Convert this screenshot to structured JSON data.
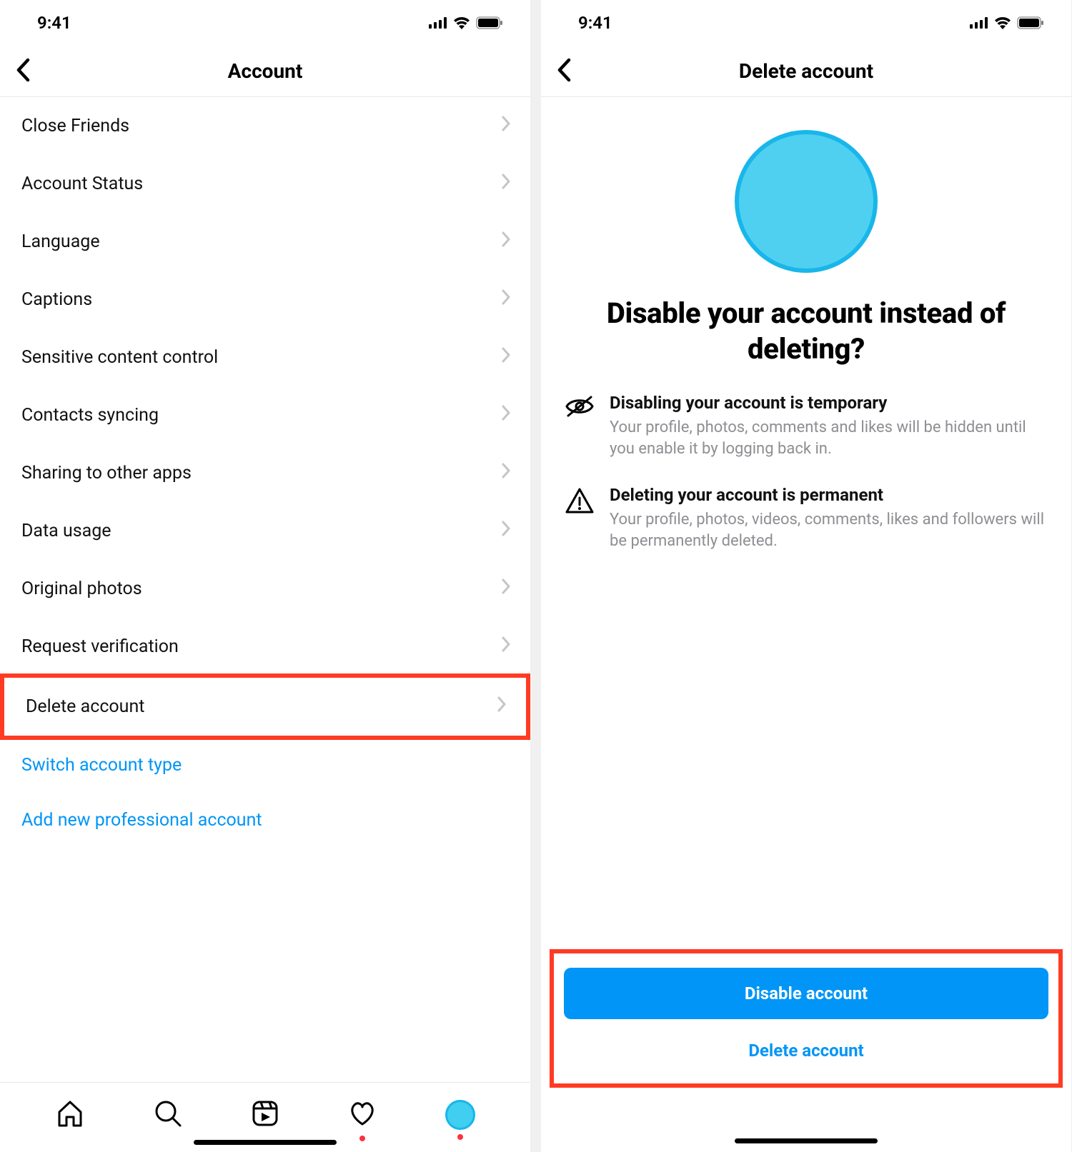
{
  "status": {
    "time": "9:41"
  },
  "left": {
    "title": "Account",
    "items": [
      "Close Friends",
      "Account Status",
      "Language",
      "Captions",
      "Sensitive content control",
      "Contacts syncing",
      "Sharing to other apps",
      "Data usage",
      "Original photos",
      "Request verification",
      "Delete account"
    ],
    "links": [
      "Switch account type",
      "Add new professional account"
    ]
  },
  "right": {
    "title": "Delete account",
    "heading": "Disable your account instead of deleting?",
    "info": [
      {
        "title": "Disabling your account is temporary",
        "desc": "Your profile, photos, comments and likes will be hidden until you enable it by logging back in."
      },
      {
        "title": "Deleting your account is permanent",
        "desc": "Your profile, photos, videos, comments, likes and followers will be permanently deleted."
      }
    ],
    "primary_button": "Disable account",
    "secondary_button": "Delete account"
  }
}
